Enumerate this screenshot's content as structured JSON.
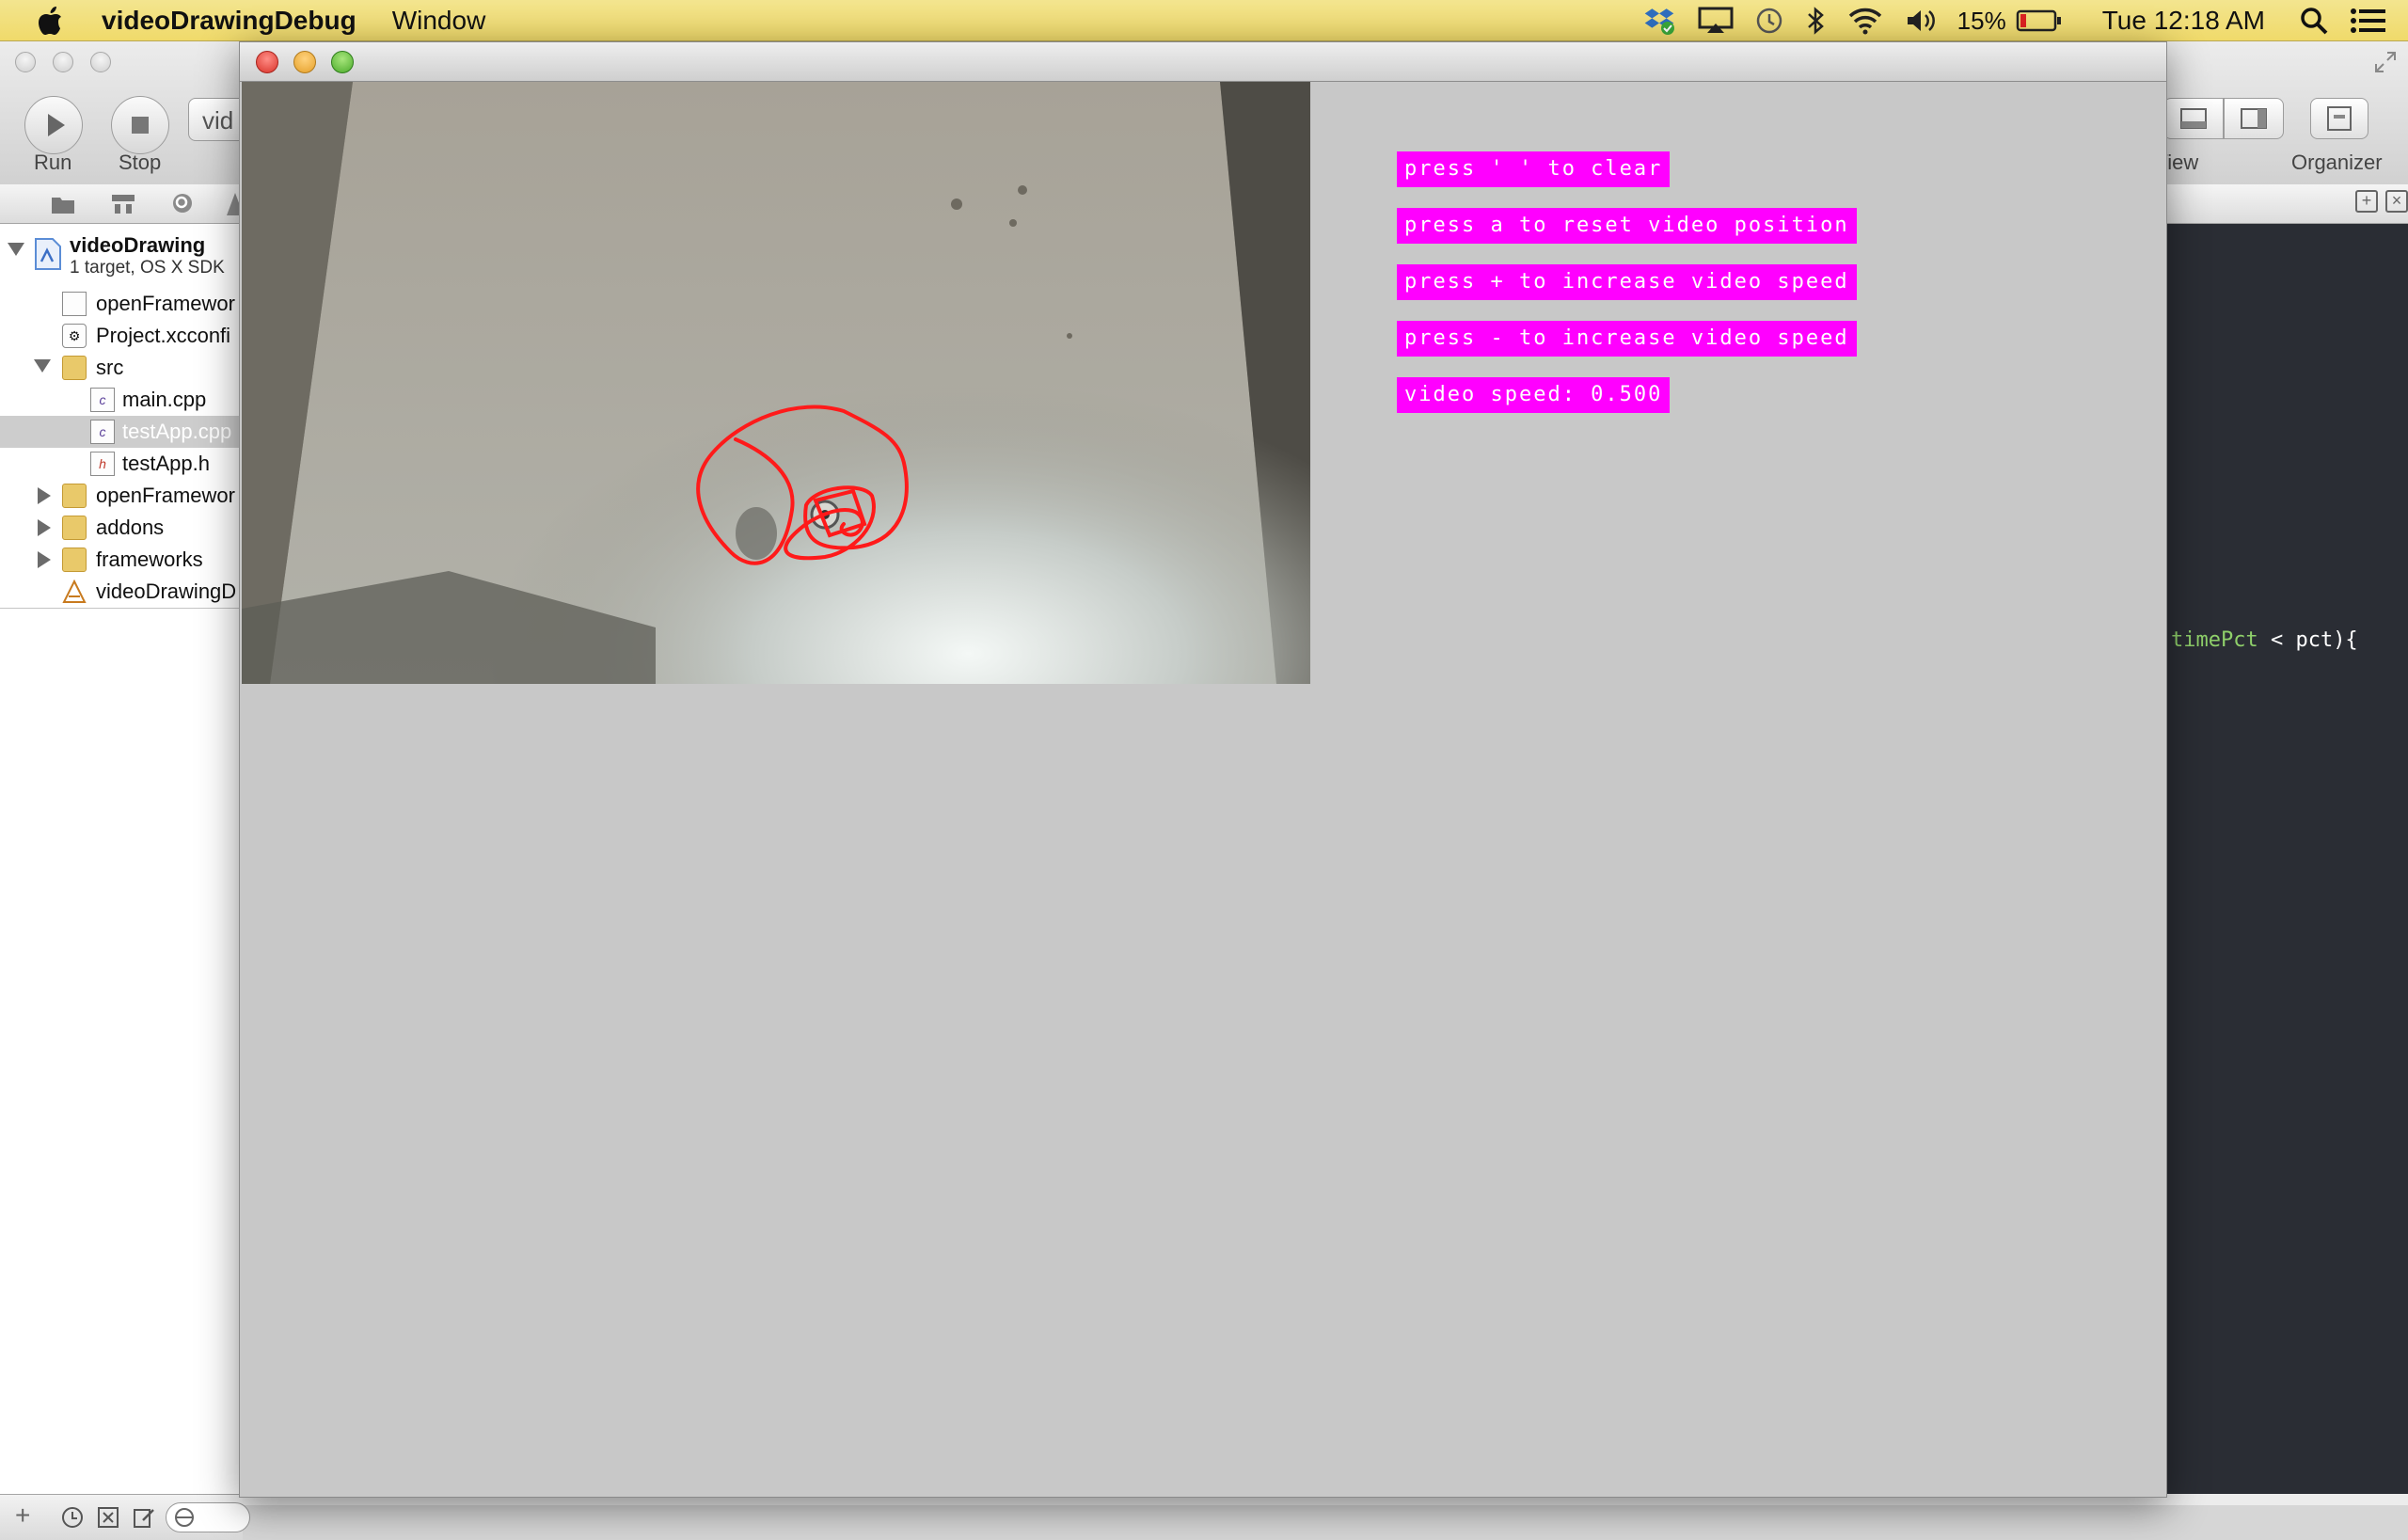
{
  "menubar": {
    "app_name": "videoDrawingDebug",
    "menus": [
      "Window"
    ],
    "battery_percent": "15%",
    "clock": "Tue 12:18 AM",
    "icons": [
      "apple-icon",
      "dropbox-icon",
      "airplay-icon",
      "time-machine-icon",
      "bluetooth-icon",
      "wifi-icon",
      "volume-icon",
      "battery-icon",
      "spotlight-icon",
      "notification-center-icon"
    ]
  },
  "xcode": {
    "toolbar": {
      "run_label": "Run",
      "stop_label": "Stop",
      "scheme_text": "vid",
      "view_label": "View",
      "organizer_label": "Organizer"
    },
    "navigator": {
      "project_name": "videoDrawing",
      "project_subtitle": "1 target, OS X SDK",
      "items": [
        {
          "label": "openFramewor",
          "kind": "file"
        },
        {
          "label": "Project.xcconfi",
          "kind": "config"
        },
        {
          "label": "src",
          "kind": "folder"
        },
        {
          "label": "main.cpp",
          "kind": "cpp"
        },
        {
          "label": "testApp.cpp",
          "kind": "cpp"
        },
        {
          "label": "testApp.h",
          "kind": "h"
        },
        {
          "label": "openFramewor",
          "kind": "folder"
        },
        {
          "label": "addons",
          "kind": "folder"
        },
        {
          "label": "frameworks",
          "kind": "folder"
        },
        {
          "label": "videoDrawingD",
          "kind": "app"
        }
      ],
      "selected": "testApp.cpp"
    },
    "editor": {
      "code_ident": "timePct",
      "code_rest": " < pct){"
    }
  },
  "of_window": {
    "overlay_lines": [
      "press ' ' to clear",
      "press a to reset video position",
      "press + to increase video speed",
      "press - to increase video speed",
      "video speed: 0.500"
    ],
    "overlay_color": "#ff00ff"
  }
}
